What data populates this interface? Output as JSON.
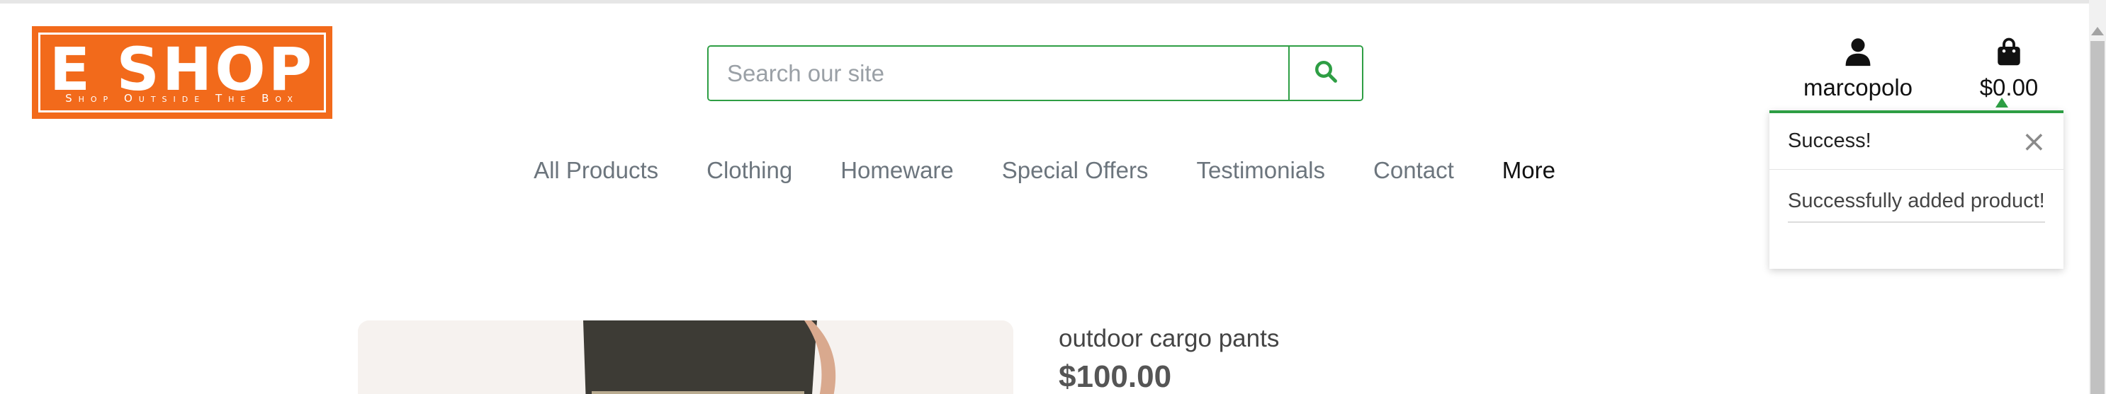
{
  "header": {
    "logo": {
      "title": "E SHOP",
      "subtitle": "Shop Outside The Box"
    },
    "search": {
      "placeholder": "Search our site",
      "value": ""
    },
    "account": {
      "label": "marcopolo"
    },
    "cart": {
      "total": "$0.00"
    }
  },
  "toast": {
    "title": "Success!",
    "message": "Successfully added product!",
    "accent_color": "#2e9e44"
  },
  "nav": {
    "items": [
      "All Products",
      "Clothing",
      "Homeware",
      "Special Offers",
      "Testimonials",
      "Contact"
    ],
    "more_label": "More"
  },
  "product": {
    "name": "outdoor cargo pants",
    "price": "$100.00"
  },
  "colors": {
    "brand_orange": "#f26a1b",
    "accent_green": "#2e9e44",
    "nav_text": "#6c757d"
  }
}
